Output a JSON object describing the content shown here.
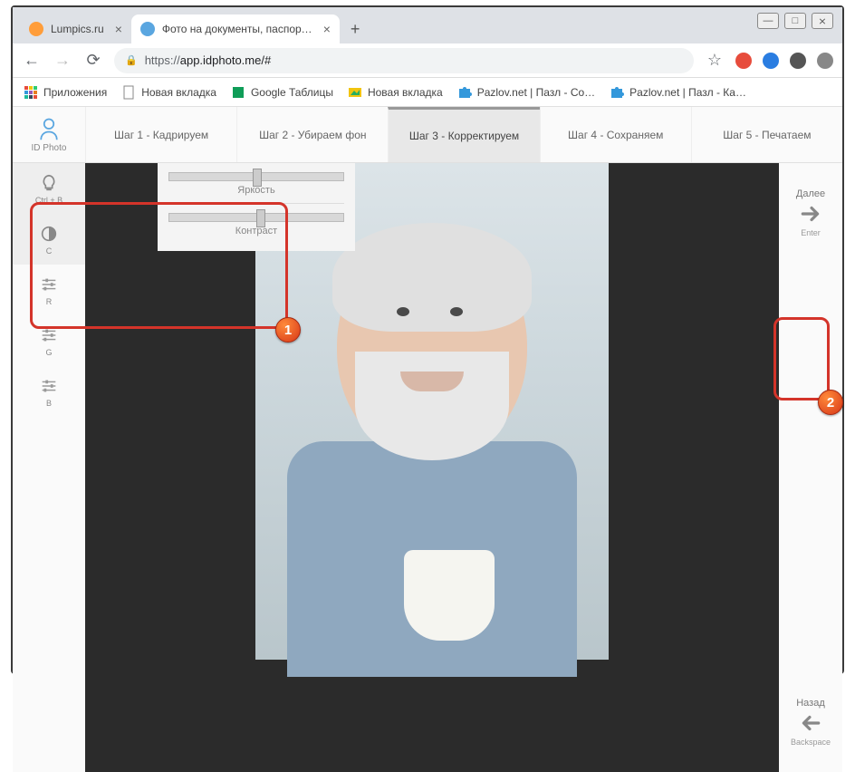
{
  "window": {
    "min": "—",
    "max": "□",
    "close": "⨯"
  },
  "tabs": [
    {
      "title": "Lumpics.ru",
      "icon_color": "#ff9d3a"
    },
    {
      "title": "Фото на документы, паспорта, в",
      "icon_color": "#5aa6e0"
    }
  ],
  "addr": {
    "protocol": "https://",
    "host_path": "app.idphoto.me/#",
    "star": "☆"
  },
  "bookmarks": [
    {
      "label": "Приложения",
      "type": "apps"
    },
    {
      "label": "Новая вкладка",
      "type": "doc"
    },
    {
      "label": "Google Таблицы",
      "type": "sheets"
    },
    {
      "label": "Новая вкладка",
      "type": "img"
    },
    {
      "label": "Pazlov.net | Пазл - Со…",
      "type": "puzzle"
    },
    {
      "label": "Pazlov.net | Пазл - Ка…",
      "type": "puzzle"
    }
  ],
  "logo_label": "ID Photo",
  "steps": [
    "Шаг 1 - Кадрируем",
    "Шаг 2 - Убираем фон",
    "Шаг 3 - Корректируем",
    "Шаг 4 - Сохраняем",
    "Шаг 5 - Печатаем"
  ],
  "active_step_index": 2,
  "left_tools": [
    {
      "hotkey": "Ctrl + B",
      "icon": "bulb"
    },
    {
      "hotkey": "C",
      "icon": "contrast"
    },
    {
      "hotkey": "R",
      "icon": "sliders"
    },
    {
      "hotkey": "G",
      "icon": "sliders"
    },
    {
      "hotkey": "B",
      "icon": "sliders"
    }
  ],
  "sliders": {
    "brightness": {
      "label": "Яркость",
      "pos_percent": 48
    },
    "contrast": {
      "label": "Контраст",
      "pos_percent": 50
    }
  },
  "right_actions": {
    "next": {
      "label": "Далее",
      "kbd": "Enter"
    },
    "back": {
      "label": "Назад",
      "kbd": "Backspace"
    }
  },
  "callouts": {
    "1": "1",
    "2": "2"
  }
}
